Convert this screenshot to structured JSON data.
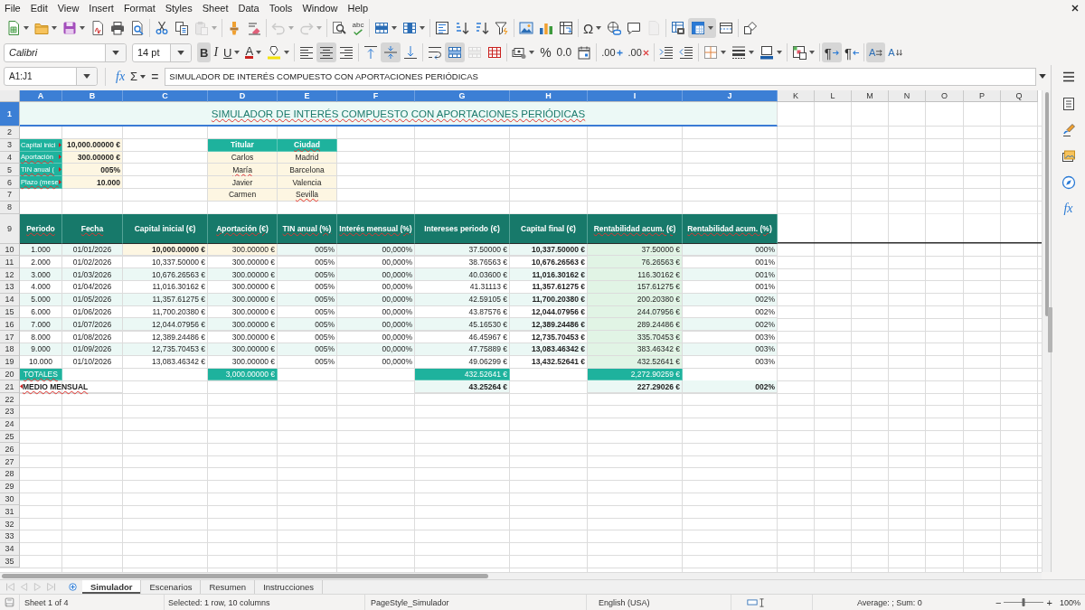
{
  "menu_bar": [
    "File",
    "Edit",
    "View",
    "Insert",
    "Format",
    "Styles",
    "Sheet",
    "Data",
    "Tools",
    "Window",
    "Help"
  ],
  "standard_toolbar": [
    {
      "on": false,
      "disabled": false
    },
    {
      "on": false,
      "disabled": false
    },
    {
      "on": false,
      "disabled": false
    },
    {
      "on": false,
      "disabled": false
    },
    {
      "on": false,
      "disabled": false
    },
    {
      "on": false,
      "disabled": false
    },
    {
      "on": false,
      "disabled": false
    },
    {
      "on": false,
      "disabled": false
    },
    {
      "on": false,
      "disabled": true
    },
    {
      "on": false,
      "disabled": false
    },
    {
      "on": false,
      "disabled": false
    },
    {
      "on": false,
      "disabled": true
    },
    {
      "on": false,
      "disabled": true
    },
    {
      "on": false,
      "disabled": false
    },
    {
      "label": "abc",
      "on": false,
      "disabled": false
    },
    {
      "on": false,
      "disabled": false
    },
    {
      "on": false,
      "disabled": false
    },
    {
      "on": false,
      "disabled": false
    },
    {
      "on": false,
      "disabled": false
    },
    {
      "on": false,
      "disabled": false
    },
    {
      "on": false,
      "disabled": false
    },
    {
      "on": false,
      "disabled": false
    },
    {
      "on": false,
      "disabled": false
    },
    {
      "on": false,
      "disabled": false
    },
    {
      "label": "Ω",
      "on": false,
      "disabled": false
    },
    {
      "on": false,
      "disabled": false
    },
    {
      "on": false,
      "disabled": false
    },
    {
      "on": false,
      "disabled": true
    },
    {
      "on": false,
      "disabled": false
    },
    {
      "on": true,
      "disabled": false
    },
    {
      "on": false,
      "disabled": false
    },
    {
      "on": false,
      "disabled": false
    }
  ],
  "formatting_toolbar": {
    "font_name": "Calibri",
    "font_size": "14 pt",
    "buttons": [
      {
        "label": "B",
        "on": true,
        "disabled": false
      },
      {
        "label": "I",
        "on": false,
        "disabled": false
      },
      {
        "label": "U",
        "on": false,
        "disabled": false
      },
      {
        "label": "A",
        "on": false,
        "disabled": false
      },
      {
        "on": false,
        "disabled": false
      },
      {
        "on": false,
        "disabled": false
      },
      {
        "on": true,
        "disabled": false
      },
      {
        "on": false,
        "disabled": false
      },
      {
        "on": false,
        "disabled": false
      },
      {
        "on": true,
        "disabled": false
      },
      {
        "on": false,
        "disabled": false
      },
      {
        "on": false,
        "disabled": false
      },
      {
        "on": true,
        "disabled": false
      },
      {
        "on": false,
        "disabled": true
      },
      {
        "on": false,
        "disabled": false
      },
      {
        "on": false,
        "disabled": false
      },
      {
        "label": "%",
        "on": false,
        "disabled": false
      },
      {
        "label": "0.0",
        "on": false,
        "disabled": false
      },
      {
        "on": false,
        "disabled": false
      },
      {
        "label": ".00",
        "on": false,
        "disabled": false
      },
      {
        "label": ".00",
        "on": false,
        "disabled": false
      },
      {
        "on": false,
        "disabled": false
      },
      {
        "on": false,
        "disabled": false
      },
      {
        "on": false,
        "disabled": false
      },
      {
        "on": false,
        "disabled": false
      },
      {
        "on": false,
        "disabled": false
      },
      {
        "on": false,
        "disabled": false
      },
      {
        "label": "¶",
        "on": true,
        "disabled": false
      },
      {
        "label": "¶",
        "on": false,
        "disabled": false
      },
      {
        "label": "A",
        "on": true,
        "disabled": false
      },
      {
        "label": "A",
        "on": false,
        "disabled": false
      }
    ]
  },
  "formula_bar": {
    "name_box": "A1:J1",
    "function_wizard": "fx",
    "sum": "Σ",
    "equals": "=",
    "formula": "SIMULADOR DE INTERÉS COMPUESTO CON APORTACIONES PERIÓDICAS"
  },
  "sheet": {
    "columns": [
      {
        "label": "A",
        "selected": true
      },
      {
        "label": "B",
        "selected": true
      },
      {
        "label": "C",
        "selected": true
      },
      {
        "label": "D",
        "selected": true
      },
      {
        "label": "E",
        "selected": true
      },
      {
        "label": "F",
        "selected": true
      },
      {
        "label": "G",
        "selected": true
      },
      {
        "label": "H",
        "selected": true
      },
      {
        "label": "I",
        "selected": true
      },
      {
        "label": "J",
        "selected": true
      },
      {
        "label": "K",
        "selected": false
      },
      {
        "label": "L",
        "selected": false
      },
      {
        "label": "M",
        "selected": false
      },
      {
        "label": "N",
        "selected": false
      },
      {
        "label": "O",
        "selected": false
      },
      {
        "label": "P",
        "selected": false
      },
      {
        "label": "Q",
        "selected": false
      }
    ],
    "rows": [
      {
        "label": "1",
        "selected": true
      },
      {
        "label": "2",
        "selected": false
      },
      {
        "label": "3",
        "selected": false
      },
      {
        "label": "4",
        "selected": false
      },
      {
        "label": "5",
        "selected": false
      },
      {
        "label": "6",
        "selected": false
      },
      {
        "label": "7",
        "selected": false
      },
      {
        "label": "8",
        "selected": false
      },
      {
        "label": "9",
        "selected": false
      },
      {
        "label": "10",
        "selected": false
      },
      {
        "label": "11",
        "selected": false
      },
      {
        "label": "12",
        "selected": false
      },
      {
        "label": "13",
        "selected": false
      },
      {
        "label": "14",
        "selected": false
      },
      {
        "label": "15",
        "selected": false
      },
      {
        "label": "16",
        "selected": false
      },
      {
        "label": "17",
        "selected": false
      },
      {
        "label": "18",
        "selected": false
      },
      {
        "label": "19",
        "selected": false
      },
      {
        "label": "20",
        "selected": false
      },
      {
        "label": "21",
        "selected": false
      },
      {
        "label": "22",
        "selected": false
      },
      {
        "label": "23",
        "selected": false
      },
      {
        "label": "24",
        "selected": false
      },
      {
        "label": "25",
        "selected": false
      },
      {
        "label": "26",
        "selected": false
      },
      {
        "label": "27",
        "selected": false
      },
      {
        "label": "28",
        "selected": false
      },
      {
        "label": "29",
        "selected": false
      },
      {
        "label": "30",
        "selected": false
      },
      {
        "label": "31",
        "selected": false
      },
      {
        "label": "32",
        "selected": false
      },
      {
        "label": "33",
        "selected": false
      },
      {
        "label": "34",
        "selected": false
      },
      {
        "label": "35",
        "selected": false
      }
    ],
    "title": {
      "text": "SIMULADOR DE INTERÉS COMPUESTO CON APORTACIONES PERIÓDICAS",
      "misspelled": true
    },
    "parameters": [
      {
        "label": "Capital inici",
        "overflow": true,
        "misspelled": false,
        "value": "10,000.00000 €"
      },
      {
        "label": "Aportación",
        "overflow": true,
        "misspelled": true,
        "value": "300.00000 €"
      },
      {
        "label": "TIN anual (",
        "overflow": true,
        "misspelled": true,
        "value": "005%"
      },
      {
        "label": "Plazo (mese",
        "overflow": true,
        "misspelled": true,
        "value": "10.000"
      }
    ],
    "holders": {
      "columns": [
        {
          "text": "Titular",
          "misspelled": false
        },
        {
          "text": "Ciudad",
          "misspelled": true
        }
      ],
      "rows": [
        [
          {
            "text": "Carlos",
            "misspelled": false
          },
          {
            "text": "Madrid",
            "misspelled": false
          }
        ],
        [
          {
            "text": "María",
            "misspelled": true
          },
          {
            "text": "Barcelona",
            "misspelled": false
          }
        ],
        [
          {
            "text": "Javier",
            "misspelled": false
          },
          {
            "text": "Valencia",
            "misspelled": false
          }
        ],
        [
          {
            "text": "Carmen",
            "misspelled": false
          },
          {
            "text": "Sevilla",
            "misspelled": true
          }
        ]
      ]
    },
    "schedule": {
      "columns": [
        {
          "text": "Periodo",
          "misspelled": true
        },
        {
          "text": "Fecha",
          "misspelled": true
        },
        {
          "text": "Capital inicial (€)",
          "misspelled": false
        },
        {
          "text": "Aportación (€)",
          "misspelled": true
        },
        {
          "text": "TIN anual (%)",
          "misspelled": true
        },
        {
          "text": "Interés mensual (%)",
          "misspelled": true
        },
        {
          "text": "Intereses periodo (€)",
          "misspelled": false
        },
        {
          "text": "Capital final (€)",
          "misspelled": false
        },
        {
          "text": "Rentabilidad acum. (€)",
          "misspelled": true
        },
        {
          "text": "Rentabilidad acum. (%)",
          "misspelled": true
        }
      ],
      "rows": [
        [
          "1.000",
          "01/01/2026",
          "10,000.00000 €",
          "300.00000 €",
          "005%",
          "00,000%",
          "37.50000 €",
          "10,337.50000 €",
          "37.50000 €",
          "000%"
        ],
        [
          "2.000",
          "01/02/2026",
          "10,337.50000 €",
          "300.00000 €",
          "005%",
          "00,000%",
          "38.76563 €",
          "10,676.26563 €",
          "76.26563 €",
          "001%"
        ],
        [
          "3.000",
          "01/03/2026",
          "10,676.26563 €",
          "300.00000 €",
          "005%",
          "00,000%",
          "40.03600 €",
          "11,016.30162 €",
          "116.30162 €",
          "001%"
        ],
        [
          "4.000",
          "01/04/2026",
          "11,016.30162 €",
          "300.00000 €",
          "005%",
          "00,000%",
          "41.31113 €",
          "11,357.61275 €",
          "157.61275 €",
          "001%"
        ],
        [
          "5.000",
          "01/05/2026",
          "11,357.61275 €",
          "300.00000 €",
          "005%",
          "00,000%",
          "42.59105 €",
          "11,700.20380 €",
          "200.20380 €",
          "002%"
        ],
        [
          "6.000",
          "01/06/2026",
          "11,700.20380 €",
          "300.00000 €",
          "005%",
          "00,000%",
          "43.87576 €",
          "12,044.07956 €",
          "244.07956 €",
          "002%"
        ],
        [
          "7.000",
          "01/07/2026",
          "12,044.07956 €",
          "300.00000 €",
          "005%",
          "00,000%",
          "45.16530 €",
          "12,389.24486 €",
          "289.24486 €",
          "002%"
        ],
        [
          "8.000",
          "01/08/2026",
          "12,389.24486 €",
          "300.00000 €",
          "005%",
          "00,000%",
          "46.45967 €",
          "12,735.70453 €",
          "335.70453 €",
          "003%"
        ],
        [
          "9.000",
          "01/09/2026",
          "12,735.70453 €",
          "300.00000 €",
          "005%",
          "00,000%",
          "47.75889 €",
          "13,083.46342 €",
          "383.46342 €",
          "003%"
        ],
        [
          "10.000",
          "01/10/2026",
          "13,083.46342 €",
          "300.00000 €",
          "005%",
          "00,000%",
          "49.06299 €",
          "13,432.52641 €",
          "432.52641 €",
          "003%"
        ]
      ],
      "totals": {
        "label": "TOTALES",
        "misspelled": true,
        "aportacion": "3,000.00000 €",
        "intereses": "432.52641 €",
        "rentabilidad": "2,272.90259 €"
      },
      "average": {
        "label": "MEDIO MENSUAL",
        "misspelled": true,
        "overflow": true,
        "intereses": "43.25264 €",
        "rentabilidad": "227.29026 €",
        "rentabilidad_pct": "002%"
      }
    }
  },
  "sidebar": {
    "functions": "fx"
  },
  "sheet_tabs": {
    "navigation": [
      {
        "disabled": true
      },
      {
        "disabled": true
      },
      {
        "disabled": true
      },
      {
        "disabled": true
      }
    ],
    "tabs": [
      {
        "label": "Simulador",
        "selected": true
      },
      {
        "label": "Escenarios",
        "selected": false
      },
      {
        "label": "Resumen",
        "selected": false
      },
      {
        "label": "Instrucciones",
        "selected": false
      }
    ]
  },
  "status_bar": {
    "sheet": "Sheet 1 of 4",
    "selection": "Selected: 1 row, 10 columns",
    "page_style": "PageStyle_Simulador",
    "language": "English (USA)",
    "summary": "Average: ; Sum: 0",
    "zoom": {
      "minus": "−",
      "plus": "+",
      "level": 0.5,
      "value": "100%"
    }
  }
}
